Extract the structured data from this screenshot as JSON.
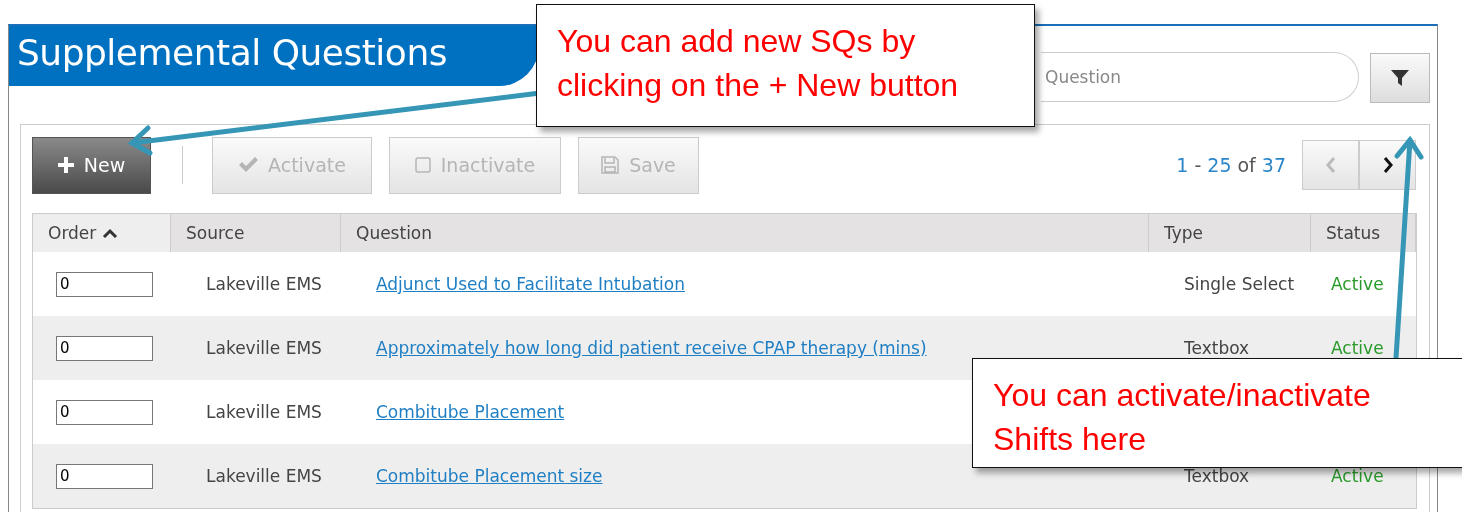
{
  "window": {
    "title": "Supplemental Questions"
  },
  "search": {
    "placeholder": "Question"
  },
  "toolbar": {
    "buttons": [
      {
        "kind": "new",
        "label": "New"
      },
      {
        "kind": "activate",
        "label": "Activate",
        "disabled": true
      },
      {
        "kind": "inactivate",
        "label": "Inactivate",
        "disabled": true
      },
      {
        "kind": "save",
        "label": "Save",
        "disabled": true
      }
    ]
  },
  "pager": {
    "range_start": "1",
    "dash": "-",
    "range_end": "25",
    "of_label": "of",
    "total": "37",
    "prev_disabled": true,
    "next_disabled": false
  },
  "table": {
    "columns": [
      {
        "label": "Order",
        "sorted": true
      },
      {
        "label": "Source",
        "sorted": false
      },
      {
        "label": "Question",
        "sorted": false
      },
      {
        "label": "Type",
        "sorted": false
      },
      {
        "label": "Status",
        "sorted": false
      }
    ],
    "rows": [
      {
        "order": "0",
        "source": "Lakeville EMS",
        "question": "Adjunct Used to Facilitate Intubation",
        "type": "Single Select",
        "status": "Active"
      },
      {
        "order": "0",
        "source": "Lakeville EMS",
        "question": "Approximately how long did patient receive CPAP therapy (mins)",
        "type": "Textbox",
        "status": "Active"
      },
      {
        "order": "0",
        "source": "Lakeville EMS",
        "question": "Combitube Placement"
      },
      {
        "order": "0",
        "source": "Lakeville EMS",
        "question": "Combitube Placement size",
        "type": "Textbox",
        "status": "Active"
      }
    ]
  },
  "callouts": [
    {
      "text": "You can add new SQs by clicking on the + New button"
    },
    {
      "text": "You can activate/inactivate Shifts here"
    }
  ]
}
